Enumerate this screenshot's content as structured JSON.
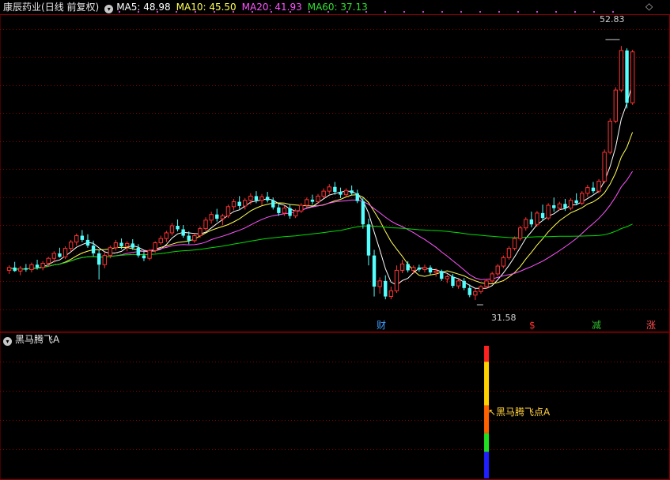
{
  "header": {
    "stock_name": "康辰药业",
    "period": "(日线 前复权)",
    "ma5": "MA5: 48.98",
    "ma10": "MA10: 45.50",
    "ma20": "MA20: 41.93",
    "ma60": "MA60: 37.13"
  },
  "price_labels": {
    "high": "52.83",
    "low": "31.58"
  },
  "event_markers": [
    {
      "text": "财",
      "color": "#3fa0ff"
    },
    {
      "text": "$",
      "color": "#ff3030"
    },
    {
      "text": "减",
      "color": "#30c030"
    },
    {
      "text": "涨",
      "color": "#ff5050"
    }
  ],
  "indicator": {
    "name": "黑马腾飞A",
    "signal_label": "↖黑马腾飞点A"
  },
  "colors": {
    "up": "#ff3232",
    "down": "#54ffff",
    "ma5": "#ffffff",
    "ma10": "#ffff55",
    "ma20": "#ff55ff",
    "ma60": "#00e000",
    "grid": "#8b0000",
    "signal": "#ffd040"
  },
  "chart_data": {
    "type": "candlestick",
    "ohlc": [
      {
        "o": 21.1,
        "h": 21.8,
        "l": 20.6,
        "c": 21.5
      },
      {
        "o": 21.5,
        "h": 22.3,
        "l": 20.9,
        "c": 21.0
      },
      {
        "o": 21.0,
        "h": 21.7,
        "l": 20.4,
        "c": 21.4
      },
      {
        "o": 21.4,
        "h": 22.0,
        "l": 20.9,
        "c": 21.2
      },
      {
        "o": 21.2,
        "h": 22.2,
        "l": 20.8,
        "c": 21.9
      },
      {
        "o": 21.9,
        "h": 22.6,
        "l": 21.2,
        "c": 21.5
      },
      {
        "o": 21.5,
        "h": 22.4,
        "l": 21.1,
        "c": 22.1
      },
      {
        "o": 22.1,
        "h": 23.0,
        "l": 21.6,
        "c": 22.8
      },
      {
        "o": 22.8,
        "h": 23.8,
        "l": 22.2,
        "c": 23.5
      },
      {
        "o": 23.5,
        "h": 24.3,
        "l": 22.9,
        "c": 23.0
      },
      {
        "o": 23.0,
        "h": 24.5,
        "l": 22.7,
        "c": 24.2
      },
      {
        "o": 24.2,
        "h": 25.4,
        "l": 23.8,
        "c": 25.1
      },
      {
        "o": 25.1,
        "h": 26.3,
        "l": 24.6,
        "c": 26.0
      },
      {
        "o": 26.0,
        "h": 26.8,
        "l": 25.1,
        "c": 25.4
      },
      {
        "o": 25.4,
        "h": 26.2,
        "l": 24.3,
        "c": 24.6
      },
      {
        "o": 24.6,
        "h": 25.3,
        "l": 23.1,
        "c": 23.5
      },
      {
        "o": 23.5,
        "h": 24.0,
        "l": 19.8,
        "c": 21.9
      },
      {
        "o": 21.9,
        "h": 23.6,
        "l": 21.4,
        "c": 23.2
      },
      {
        "o": 23.2,
        "h": 24.6,
        "l": 22.8,
        "c": 24.3
      },
      {
        "o": 24.3,
        "h": 25.4,
        "l": 23.9,
        "c": 25.0
      },
      {
        "o": 25.0,
        "h": 25.6,
        "l": 24.1,
        "c": 24.5
      },
      {
        "o": 24.5,
        "h": 25.2,
        "l": 23.8,
        "c": 24.9
      },
      {
        "o": 24.9,
        "h": 25.5,
        "l": 24.0,
        "c": 24.3
      },
      {
        "o": 24.3,
        "h": 24.8,
        "l": 22.9,
        "c": 23.2
      },
      {
        "o": 23.2,
        "h": 23.9,
        "l": 22.4,
        "c": 22.8
      },
      {
        "o": 22.8,
        "h": 24.1,
        "l": 22.5,
        "c": 23.9
      },
      {
        "o": 23.9,
        "h": 25.2,
        "l": 23.6,
        "c": 25.0
      },
      {
        "o": 25.0,
        "h": 26.0,
        "l": 24.7,
        "c": 25.6
      },
      {
        "o": 25.6,
        "h": 26.7,
        "l": 25.1,
        "c": 26.4
      },
      {
        "o": 26.4,
        "h": 27.8,
        "l": 26.0,
        "c": 27.4
      },
      {
        "o": 27.4,
        "h": 28.3,
        "l": 26.6,
        "c": 26.9
      },
      {
        "o": 26.9,
        "h": 27.5,
        "l": 25.7,
        "c": 26.0
      },
      {
        "o": 26.0,
        "h": 26.6,
        "l": 24.8,
        "c": 25.3
      },
      {
        "o": 25.3,
        "h": 26.3,
        "l": 25.0,
        "c": 26.0
      },
      {
        "o": 26.0,
        "h": 27.3,
        "l": 25.7,
        "c": 27.0
      },
      {
        "o": 27.0,
        "h": 28.6,
        "l": 26.7,
        "c": 28.2
      },
      {
        "o": 28.2,
        "h": 29.4,
        "l": 27.7,
        "c": 29.0
      },
      {
        "o": 29.0,
        "h": 29.8,
        "l": 28.0,
        "c": 28.4
      },
      {
        "o": 28.4,
        "h": 29.1,
        "l": 27.5,
        "c": 28.8
      },
      {
        "o": 28.8,
        "h": 30.4,
        "l": 28.5,
        "c": 30.1
      },
      {
        "o": 30.1,
        "h": 31.2,
        "l": 29.6,
        "c": 30.8
      },
      {
        "o": 30.8,
        "h": 31.6,
        "l": 29.8,
        "c": 30.2
      },
      {
        "o": 30.2,
        "h": 31.3,
        "l": 29.7,
        "c": 31.0
      },
      {
        "o": 31.0,
        "h": 32.0,
        "l": 30.4,
        "c": 31.6
      },
      {
        "o": 31.6,
        "h": 32.3,
        "l": 30.6,
        "c": 31.0
      },
      {
        "o": 31.0,
        "h": 31.9,
        "l": 30.3,
        "c": 31.5
      },
      {
        "o": 31.5,
        "h": 32.2,
        "l": 30.7,
        "c": 31.0
      },
      {
        "o": 31.0,
        "h": 31.4,
        "l": 29.7,
        "c": 30.0
      },
      {
        "o": 30.0,
        "h": 30.6,
        "l": 28.8,
        "c": 29.2
      },
      {
        "o": 29.2,
        "h": 30.2,
        "l": 28.8,
        "c": 29.9
      },
      {
        "o": 29.9,
        "h": 30.4,
        "l": 28.4,
        "c": 28.8
      },
      {
        "o": 28.8,
        "h": 29.8,
        "l": 28.5,
        "c": 29.5
      },
      {
        "o": 29.5,
        "h": 30.6,
        "l": 29.2,
        "c": 30.3
      },
      {
        "o": 30.3,
        "h": 31.4,
        "l": 30.0,
        "c": 31.1
      },
      {
        "o": 31.1,
        "h": 31.8,
        "l": 30.4,
        "c": 30.8
      },
      {
        "o": 30.8,
        "h": 31.9,
        "l": 30.5,
        "c": 31.6
      },
      {
        "o": 31.6,
        "h": 32.7,
        "l": 31.3,
        "c": 32.3
      },
      {
        "o": 32.3,
        "h": 33.3,
        "l": 31.9,
        "c": 32.9
      },
      {
        "o": 32.9,
        "h": 33.6,
        "l": 31.8,
        "c": 32.2
      },
      {
        "o": 32.2,
        "h": 32.8,
        "l": 31.3,
        "c": 31.8
      },
      {
        "o": 31.8,
        "h": 32.7,
        "l": 31.5,
        "c": 32.4
      },
      {
        "o": 32.4,
        "h": 33.1,
        "l": 31.7,
        "c": 32.0
      },
      {
        "o": 32.0,
        "h": 32.5,
        "l": 30.6,
        "c": 30.9
      },
      {
        "o": 30.9,
        "h": 31.4,
        "l": 27.0,
        "c": 27.6
      },
      {
        "o": 27.6,
        "h": 28.4,
        "l": 21.8,
        "c": 23.2
      },
      {
        "o": 23.2,
        "h": 24.0,
        "l": 17.4,
        "c": 18.8
      },
      {
        "o": 18.8,
        "h": 20.1,
        "l": 17.8,
        "c": 19.6
      },
      {
        "o": 19.6,
        "h": 20.4,
        "l": 17.0,
        "c": 17.4
      },
      {
        "o": 17.4,
        "h": 18.8,
        "l": 17.0,
        "c": 18.2
      },
      {
        "o": 18.2,
        "h": 21.8,
        "l": 17.9,
        "c": 21.1
      },
      {
        "o": 21.1,
        "h": 22.6,
        "l": 20.7,
        "c": 22.0
      },
      {
        "o": 22.0,
        "h": 22.4,
        "l": 20.8,
        "c": 21.1
      },
      {
        "o": 21.1,
        "h": 21.8,
        "l": 20.6,
        "c": 21.5
      },
      {
        "o": 21.5,
        "h": 21.9,
        "l": 20.9,
        "c": 21.2
      },
      {
        "o": 21.2,
        "h": 21.9,
        "l": 20.8,
        "c": 21.5
      },
      {
        "o": 21.5,
        "h": 21.8,
        "l": 20.5,
        "c": 20.8
      },
      {
        "o": 20.8,
        "h": 21.4,
        "l": 20.2,
        "c": 21.0
      },
      {
        "o": 21.0,
        "h": 21.2,
        "l": 19.6,
        "c": 19.9
      },
      {
        "o": 19.9,
        "h": 20.5,
        "l": 19.3,
        "c": 20.2
      },
      {
        "o": 20.2,
        "h": 20.6,
        "l": 18.6,
        "c": 18.9
      },
      {
        "o": 18.9,
        "h": 19.9,
        "l": 18.5,
        "c": 19.6
      },
      {
        "o": 19.6,
        "h": 20.0,
        "l": 18.3,
        "c": 18.6
      },
      {
        "o": 18.6,
        "h": 19.1,
        "l": 17.3,
        "c": 17.6
      },
      {
        "o": 17.6,
        "h": 18.5,
        "l": 16.9,
        "c": 18.1
      },
      {
        "o": 18.1,
        "h": 19.0,
        "l": 17.8,
        "c": 18.8
      },
      {
        "o": 18.8,
        "h": 19.9,
        "l": 18.5,
        "c": 19.6
      },
      {
        "o": 19.6,
        "h": 20.9,
        "l": 19.3,
        "c": 20.6
      },
      {
        "o": 20.6,
        "h": 22.0,
        "l": 20.3,
        "c": 21.7
      },
      {
        "o": 21.7,
        "h": 23.2,
        "l": 21.4,
        "c": 22.9
      },
      {
        "o": 22.9,
        "h": 24.5,
        "l": 22.6,
        "c": 24.2
      },
      {
        "o": 24.2,
        "h": 25.9,
        "l": 23.9,
        "c": 25.6
      },
      {
        "o": 25.6,
        "h": 27.4,
        "l": 25.3,
        "c": 27.1
      },
      {
        "o": 27.1,
        "h": 28.6,
        "l": 26.7,
        "c": 28.3
      },
      {
        "o": 28.3,
        "h": 29.4,
        "l": 27.2,
        "c": 27.6
      },
      {
        "o": 27.6,
        "h": 29.5,
        "l": 27.3,
        "c": 29.2
      },
      {
        "o": 29.2,
        "h": 30.4,
        "l": 28.1,
        "c": 28.5
      },
      {
        "o": 28.5,
        "h": 30.6,
        "l": 28.2,
        "c": 30.3
      },
      {
        "o": 30.3,
        "h": 31.4,
        "l": 29.4,
        "c": 29.9
      },
      {
        "o": 29.9,
        "h": 30.8,
        "l": 29.6,
        "c": 30.5
      },
      {
        "o": 30.5,
        "h": 31.2,
        "l": 29.5,
        "c": 29.9
      },
      {
        "o": 29.9,
        "h": 31.3,
        "l": 29.6,
        "c": 31.0
      },
      {
        "o": 31.0,
        "h": 32.0,
        "l": 30.3,
        "c": 30.6
      },
      {
        "o": 30.6,
        "h": 32.3,
        "l": 30.3,
        "c": 32.0
      },
      {
        "o": 32.0,
        "h": 33.2,
        "l": 31.5,
        "c": 32.8
      },
      {
        "o": 32.8,
        "h": 33.6,
        "l": 32.0,
        "c": 32.3
      },
      {
        "o": 32.3,
        "h": 34.0,
        "l": 32.0,
        "c": 33.7
      },
      {
        "o": 33.7,
        "h": 38.2,
        "l": 33.4,
        "c": 37.8
      },
      {
        "o": 37.8,
        "h": 42.6,
        "l": 37.5,
        "c": 42.2
      },
      {
        "o": 42.2,
        "h": 47.0,
        "l": 41.9,
        "c": 46.6
      },
      {
        "o": 46.6,
        "h": 52.83,
        "l": 46.3,
        "c": 52.2
      },
      {
        "o": 52.2,
        "h": 52.5,
        "l": 44.0,
        "c": 44.8
      },
      {
        "o": 44.8,
        "h": 52.3,
        "l": 44.5,
        "c": 52.0
      }
    ],
    "high_label": 52.83,
    "low_label": 31.58,
    "ylim": [
      14,
      58
    ],
    "ma_periods": [
      5,
      10,
      20,
      60
    ],
    "indicator_bar": {
      "index": 85,
      "segments": [
        {
          "color": "#ff2020",
          "from": 0.0,
          "to": 0.12
        },
        {
          "color": "#ffd000",
          "from": 0.12,
          "to": 0.45
        },
        {
          "color": "#ff6000",
          "from": 0.45,
          "to": 0.66
        },
        {
          "color": "#20e020",
          "from": 0.66,
          "to": 0.8
        },
        {
          "color": "#2020ff",
          "from": 0.8,
          "to": 1.0
        }
      ]
    }
  }
}
